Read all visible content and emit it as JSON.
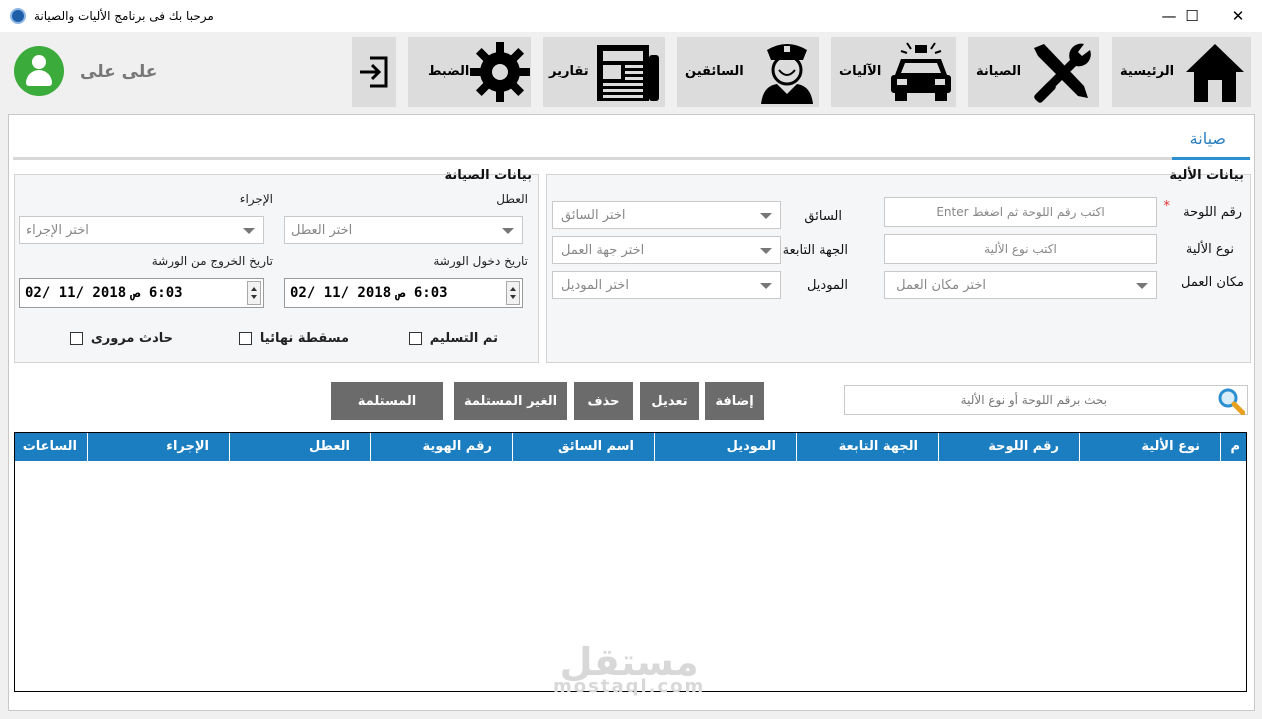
{
  "window": {
    "title": "مرحبا بك فى برنامج الأليات والصيانة",
    "minimize": "—",
    "maximize": "☐",
    "close": "✕"
  },
  "user": {
    "name": "على على"
  },
  "toolbar": {
    "logout_icon": "logout-icon",
    "settings": "الضبط",
    "reports": "تقارير",
    "drivers": "السائقين",
    "vehicles": "الآليات",
    "maintenance": "الصيانة",
    "home": "الرئيسية"
  },
  "tab": {
    "label": "صيانة"
  },
  "vehicle_group": {
    "title": "بيانات الألية",
    "plate_label": "رقم اللوحة",
    "required_mark": "*",
    "plate_placeholder": "اكتب رقم اللوحة ثم اضغط Enter",
    "type_label": "نوع الألية",
    "type_placeholder": "اكتب  نوع الألية",
    "workplace_label": "مكان العمل",
    "workplace_placeholder": "اختر مكان العمل",
    "driver_label": "السائق",
    "driver_placeholder": "اختر السائق",
    "dept_label": "الجهة التابعة",
    "dept_placeholder": "اختر جهة العمل",
    "model_label": "الموديل",
    "model_placeholder": "اختر الموديل"
  },
  "maintenance_group": {
    "title": "بيانات الصيانة",
    "fault_label": "العطل",
    "fault_placeholder": "اختر العطل",
    "action_label": "الإجراء",
    "action_placeholder": "اختر الإجراء",
    "entry_label": "تاريخ دخول الورشة",
    "entry_date": "02/ 11/ 2018",
    "entry_time": "6:03 ص",
    "exit_label": "تاريخ الخروج من الورشة",
    "exit_date": "02/ 11/ 2018",
    "exit_time": "6:03 ص",
    "delivered": "تم التسليم",
    "scrapped": "مسقطة نهائيا",
    "accident": "حادث مرورى"
  },
  "search": {
    "placeholder": "بحث برقم اللوحة أو نوع الألية"
  },
  "buttons": {
    "add": "إضافة",
    "edit": "تعديل",
    "delete": "حذف",
    "not_received": "الغير المستلمة",
    "received": "المستلمة"
  },
  "grid": {
    "columns": [
      "م",
      "نوع الألية",
      "رقم اللوحة",
      "الجهة التابعة",
      "الموديل",
      "اسم السائق",
      "رقم الهوية",
      "العطل",
      "الإجراء",
      "الساعات"
    ],
    "rows": []
  },
  "watermark": {
    "ar": "مستقل",
    "en": "mostaql.com"
  },
  "colors": {
    "accent": "#1a7ec1",
    "tab_active": "#2a8fd0",
    "button": "#6b6b6b",
    "avatar": "#3bab3b"
  }
}
